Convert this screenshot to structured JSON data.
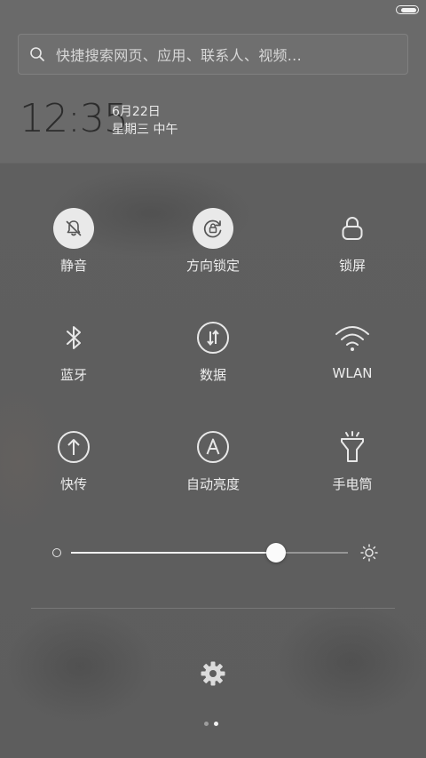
{
  "search": {
    "placeholder": "快捷搜索网页、应用、联系人、视频..."
  },
  "clock": {
    "time": "12:35",
    "date": "6月22日",
    "weekday": "星期三 中午"
  },
  "toggles": [
    {
      "label": "静音",
      "icon": "bell-off-icon",
      "active": true
    },
    {
      "label": "方向锁定",
      "icon": "rotation-lock-icon",
      "active": true
    },
    {
      "label": "锁屏",
      "icon": "lock-icon",
      "active": false
    },
    {
      "label": "蓝牙",
      "icon": "bluetooth-icon",
      "active": false
    },
    {
      "label": "数据",
      "icon": "mobile-data-icon",
      "active": false
    },
    {
      "label": "WLAN",
      "icon": "wifi-icon",
      "active": false
    },
    {
      "label": "快传",
      "icon": "share-upload-icon",
      "active": false
    },
    {
      "label": "自动亮度",
      "icon": "auto-brightness-icon",
      "active": false
    },
    {
      "label": "手电筒",
      "icon": "flashlight-icon",
      "active": false
    }
  ],
  "brightness": {
    "level": 0.74
  },
  "pager": {
    "pages": 2,
    "current": 1
  },
  "colors": {
    "active_circle": "#e9e9e9",
    "icon_light": "#e8e8e8",
    "icon_dark": "#555555",
    "clock_text": "#2c2c2c"
  }
}
